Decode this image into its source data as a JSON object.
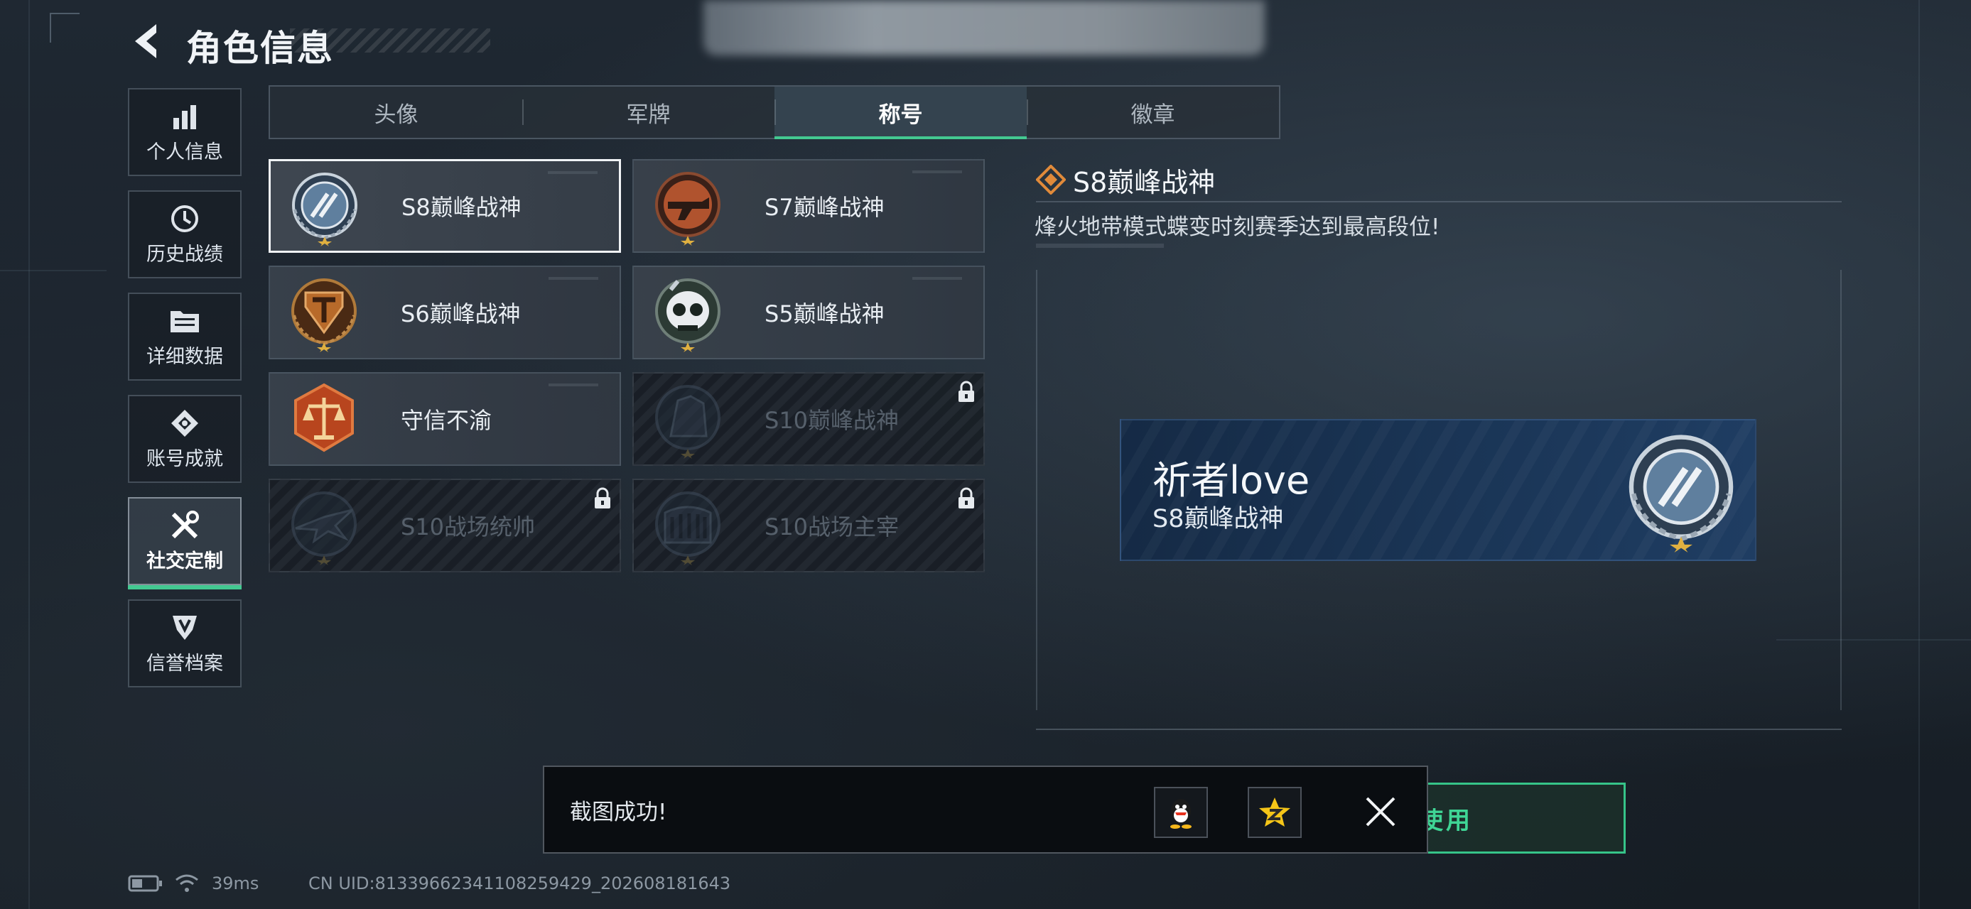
{
  "header": {
    "title": "角色信息"
  },
  "sidebar": {
    "items": [
      {
        "label": "个人信息",
        "icon": "bar-chart-icon"
      },
      {
        "label": "历史战绩",
        "icon": "clock-history-icon"
      },
      {
        "label": "详细数据",
        "icon": "folder-data-icon"
      },
      {
        "label": "账号成就",
        "icon": "achievement-icon"
      },
      {
        "label": "社交定制",
        "icon": "tools-icon",
        "active": true
      },
      {
        "label": "信誉档案",
        "icon": "shield-badge-icon"
      }
    ]
  },
  "tabs": [
    {
      "label": "头像"
    },
    {
      "label": "军牌"
    },
    {
      "label": "称号",
      "active": true
    },
    {
      "label": "徽章"
    }
  ],
  "titles": [
    {
      "name": "S8巅峰战神",
      "state": "selected",
      "emblem_color": "#5f7f9e"
    },
    {
      "name": "S7巅峰战神",
      "state": "owned",
      "emblem_color": "#b0532e"
    },
    {
      "name": "S6巅峰战神",
      "state": "owned",
      "emblem_color": "#b86a2a"
    },
    {
      "name": "S5巅峰战神",
      "state": "owned",
      "emblem_color": "#2c3a34"
    },
    {
      "name": "守信不渝",
      "state": "owned",
      "emblem_color": "#b8451e"
    },
    {
      "name": "S10巅峰战神",
      "state": "locked",
      "emblem_color": "#2d3a4a"
    },
    {
      "name": "S10战场统帅",
      "state": "locked",
      "emblem_color": "#2d3a4a"
    },
    {
      "name": "S10战场主宰",
      "state": "locked",
      "emblem_color": "#2d3a4a"
    }
  ],
  "detail": {
    "title": "S8巅峰战神",
    "description": "烽火地带模式蝶变时刻赛季达到最高段位!"
  },
  "preview": {
    "player_name": "祈者love",
    "title": "S8巅峰战神"
  },
  "use_button": {
    "label": "使用"
  },
  "toast": {
    "message": "截图成功!",
    "share_targets": [
      "qq-icon",
      "qzone-icon"
    ]
  },
  "status_bar": {
    "ping": "39ms",
    "uid": "CN UID:8133966234110825942​9_202608181643"
  },
  "colors": {
    "accent": "#43c991",
    "selected_border": "#f0f3f6",
    "plate": "#1a3556"
  }
}
